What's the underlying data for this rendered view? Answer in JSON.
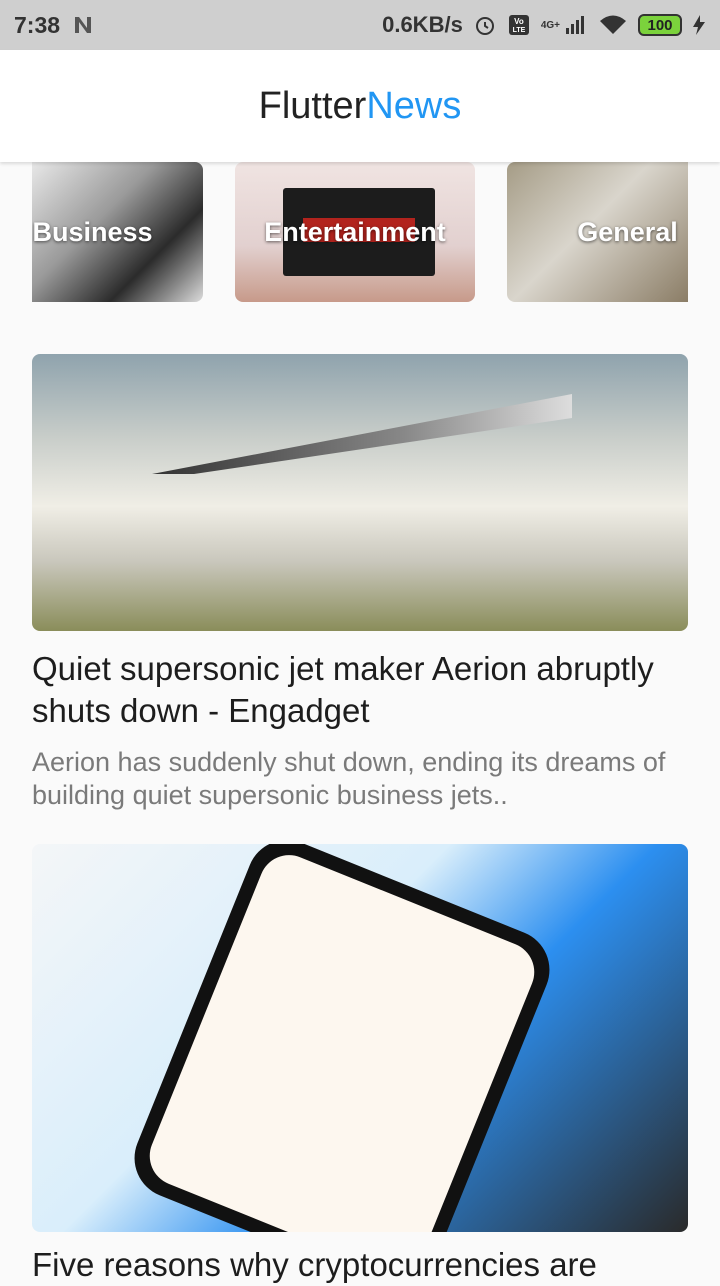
{
  "status_bar": {
    "time": "7:38",
    "network_speed": "0.6KB/s",
    "signal_label": "4G+",
    "battery": "100",
    "icons": [
      "notification-n-icon",
      "alarm-icon",
      "volte-icon",
      "signal-icon",
      "wifi-icon",
      "battery-icon",
      "charging-icon"
    ]
  },
  "app_bar": {
    "title_part1": "Flutter",
    "title_part2": "News"
  },
  "categories": [
    {
      "label": "Business"
    },
    {
      "label": "Entertainment"
    },
    {
      "label": "General"
    }
  ],
  "articles": [
    {
      "title": "Quiet supersonic jet maker Aerion abruptly shuts down - Engadget",
      "description": "Aerion has suddenly shut down, ending its dreams of building quiet supersonic business jets.."
    },
    {
      "title": "Five reasons why cryptocurrencies are"
    }
  ],
  "colors": {
    "accent": "#2196f3",
    "status_bar_bg": "#cfcfcf"
  }
}
